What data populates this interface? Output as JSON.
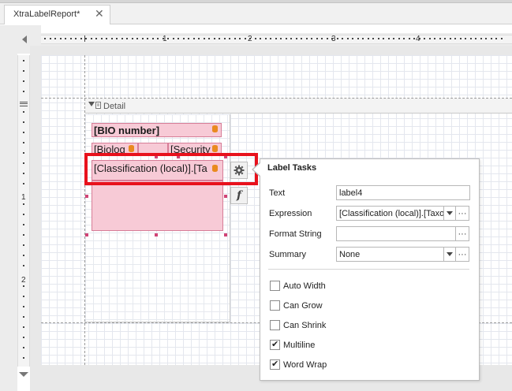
{
  "document_tab": {
    "title": "XtraLabelReport*",
    "close_glyph": "✕"
  },
  "ruler": {
    "marks": [
      "1",
      "2",
      "3",
      "4"
    ],
    "vertical_marks": [
      "1",
      "2"
    ]
  },
  "band": {
    "name": "Detail"
  },
  "controls": {
    "bio_number": "[BIO number]",
    "biolog": "[Biolog",
    "security": "[Security",
    "classification": "[Classification (local)].[Ta"
  },
  "smart_tag": {
    "gear_icon": "gear-icon",
    "function_icon": "function-icon",
    "function_glyph": "f"
  },
  "label_tasks": {
    "title": "Label Tasks",
    "text_label": "Text",
    "text_value": "label4",
    "expression_label": "Expression",
    "expression_value": "[Classification (local)].[Taxo",
    "format_string_label": "Format String",
    "format_string_value": "",
    "summary_label": "Summary",
    "summary_value": "None",
    "ellipsis": "···",
    "checkboxes": [
      {
        "label": "Auto Width",
        "checked": false
      },
      {
        "label": "Can Grow",
        "checked": false
      },
      {
        "label": "Can Shrink",
        "checked": false
      },
      {
        "label": "Multiline",
        "checked": true
      },
      {
        "label": "Word Wrap",
        "checked": true
      }
    ],
    "check_glyph": "✔"
  },
  "colors": {
    "highlight": "#e8111c",
    "control_fill": "#f7cad6",
    "control_border": "#d77d97",
    "grip": "#d04476"
  }
}
